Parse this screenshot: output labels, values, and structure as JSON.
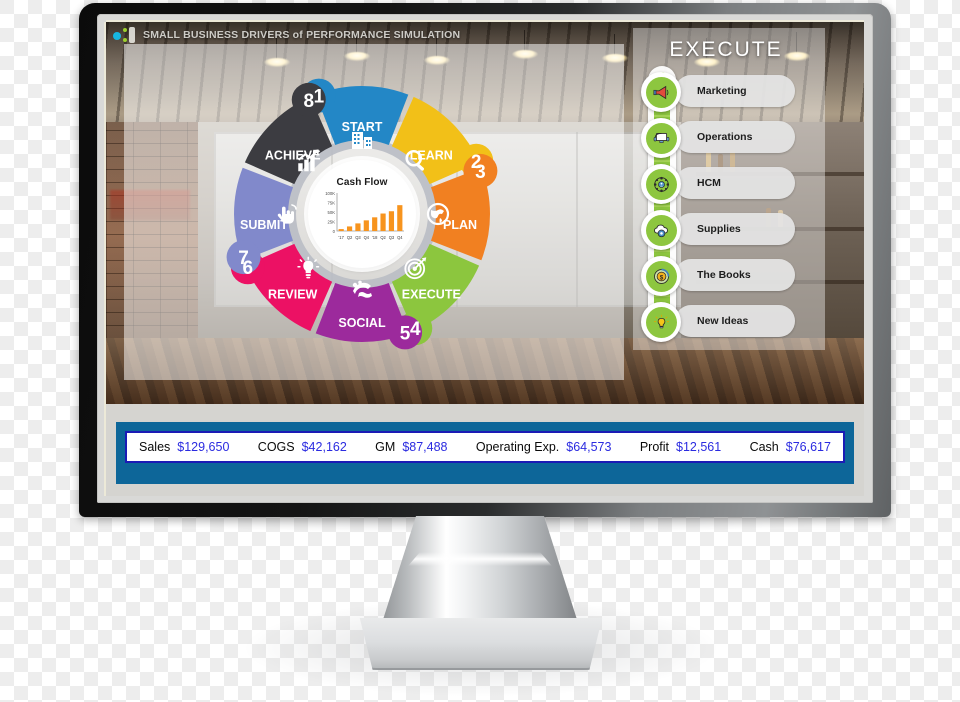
{
  "app": {
    "title": "SMALL BUSINESS DRIVERS of PERFORMANCE SIMULATION",
    "logo_icon": "cyan-green-dots-logo-icon"
  },
  "wheel": {
    "hub": {
      "title": "Cash Flow"
    },
    "segments": [
      {
        "num": "1",
        "label": "START",
        "icon": "office-buildings-icon",
        "color": "#2387c6"
      },
      {
        "num": "2",
        "label": "LEARN",
        "icon": "magnifier-icon",
        "color": "#f2c018"
      },
      {
        "num": "3",
        "label": "PLAN",
        "icon": "globe-icon",
        "color": "#f18021"
      },
      {
        "num": "4",
        "label": "EXECUTE",
        "icon": "target-bullseye-icon",
        "color": "#8cc63e"
      },
      {
        "num": "5",
        "label": "SOCIAL",
        "icon": "social-hands-icon",
        "color": "#9c2a9c"
      },
      {
        "num": "6",
        "label": "REVIEW",
        "icon": "lightbulb-icon",
        "color": "#ec1164"
      },
      {
        "num": "7",
        "label": "SUBMIT",
        "icon": "click-hand-icon",
        "color": "#8189cb"
      },
      {
        "num": "8",
        "label": "ACHIEVE",
        "icon": "growth-bar-chart-icon",
        "color": "#3c3c41"
      }
    ]
  },
  "chart_data": {
    "type": "bar",
    "title": "Cash Flow",
    "xlabel": "",
    "ylabel": "",
    "categories": [
      "'17",
      "Q2",
      "Q3",
      "Q4",
      "'18",
      "Q2",
      "Q3",
      "Q4"
    ],
    "values": [
      5000,
      12000,
      20000,
      28000,
      36000,
      46000,
      52000,
      68000
    ],
    "ytick_labels": [
      "0",
      "25K",
      "50K",
      "75K",
      "100K"
    ],
    "ytick_values": [
      0,
      25000,
      50000,
      75000,
      100000
    ],
    "ylim": [
      0,
      100000
    ],
    "bar_color": "#f7941e",
    "grid": false,
    "legend": "none"
  },
  "execute_panel": {
    "title": "EXECUTE",
    "accent_color": "#8dc63f",
    "items": [
      {
        "label": "Marketing",
        "icon": "megaphone-icon"
      },
      {
        "label": "Operations",
        "icon": "monitor-headset-icon"
      },
      {
        "label": "HCM",
        "icon": "people-network-icon"
      },
      {
        "label": "Supplies",
        "icon": "cloud-gear-icon"
      },
      {
        "label": "The Books",
        "icon": "ledger-dollar-icon"
      },
      {
        "label": "New Ideas",
        "icon": "idea-bulb-icon"
      }
    ]
  },
  "financial_bar": {
    "band_color": "#0d6699",
    "value_color": "#2b2be0",
    "metrics": [
      {
        "key": "Sales",
        "value": "$129,650"
      },
      {
        "key": "COGS",
        "value": "$42,162"
      },
      {
        "key": "GM",
        "value": "$87,488"
      },
      {
        "key": "Operating Exp.",
        "value": "$64,573"
      },
      {
        "key": "Profit",
        "value": "$12,561"
      },
      {
        "key": "Cash",
        "value": "$76,617"
      }
    ]
  }
}
